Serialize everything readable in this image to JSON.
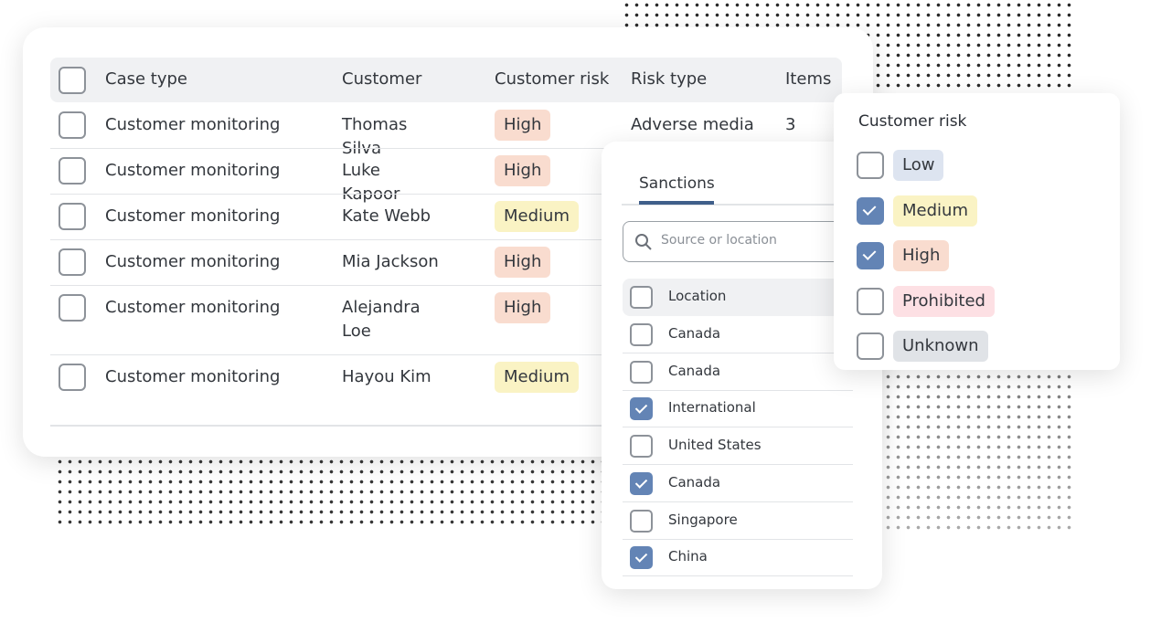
{
  "table": {
    "headers": [
      "Case type",
      "Customer",
      "Customer risk",
      "Risk type",
      "Items"
    ],
    "rows": [
      {
        "case_type": "Customer monitoring",
        "customer": "Thomas Silva",
        "risk": "High",
        "risk_type": "Adverse media",
        "items": "3"
      },
      {
        "case_type": "Customer monitoring",
        "customer": "Luke Kapoor",
        "risk": "High"
      },
      {
        "case_type": "Customer monitoring",
        "customer": "Kate Webb",
        "risk": "Medium"
      },
      {
        "case_type": "Customer monitoring",
        "customer": "Mia Jackson",
        "risk": "High"
      },
      {
        "case_type": "Customer monitoring",
        "customer": "Alejandra Loe",
        "risk": "High"
      },
      {
        "case_type": "Customer monitoring",
        "customer": "Hayou Kim",
        "risk": "Medium"
      }
    ]
  },
  "sanctions": {
    "tab": "Sanctions",
    "search_placeholder": "Source or location",
    "header": "Location",
    "items": [
      {
        "label": "Canada",
        "checked": false
      },
      {
        "label": "Canada",
        "checked": false
      },
      {
        "label": "International",
        "checked": true
      },
      {
        "label": "United States",
        "checked": false
      },
      {
        "label": "Canada",
        "checked": true
      },
      {
        "label": "Singapore",
        "checked": false
      },
      {
        "label": "China",
        "checked": true
      }
    ]
  },
  "risk_filter": {
    "title": "Customer risk",
    "options": [
      {
        "label": "Low",
        "checked": false,
        "color": "#dde4f0"
      },
      {
        "label": "Medium",
        "checked": true,
        "color": "#faf3c4"
      },
      {
        "label": "High",
        "checked": true,
        "color": "#f9dccf"
      },
      {
        "label": "Prohibited",
        "checked": false,
        "color": "#fde0e4"
      },
      {
        "label": "Unknown",
        "checked": false,
        "color": "#e0e3e7"
      }
    ]
  },
  "colors": {
    "accent": "#6384b5",
    "tab_underline": "#3f5f8a"
  }
}
